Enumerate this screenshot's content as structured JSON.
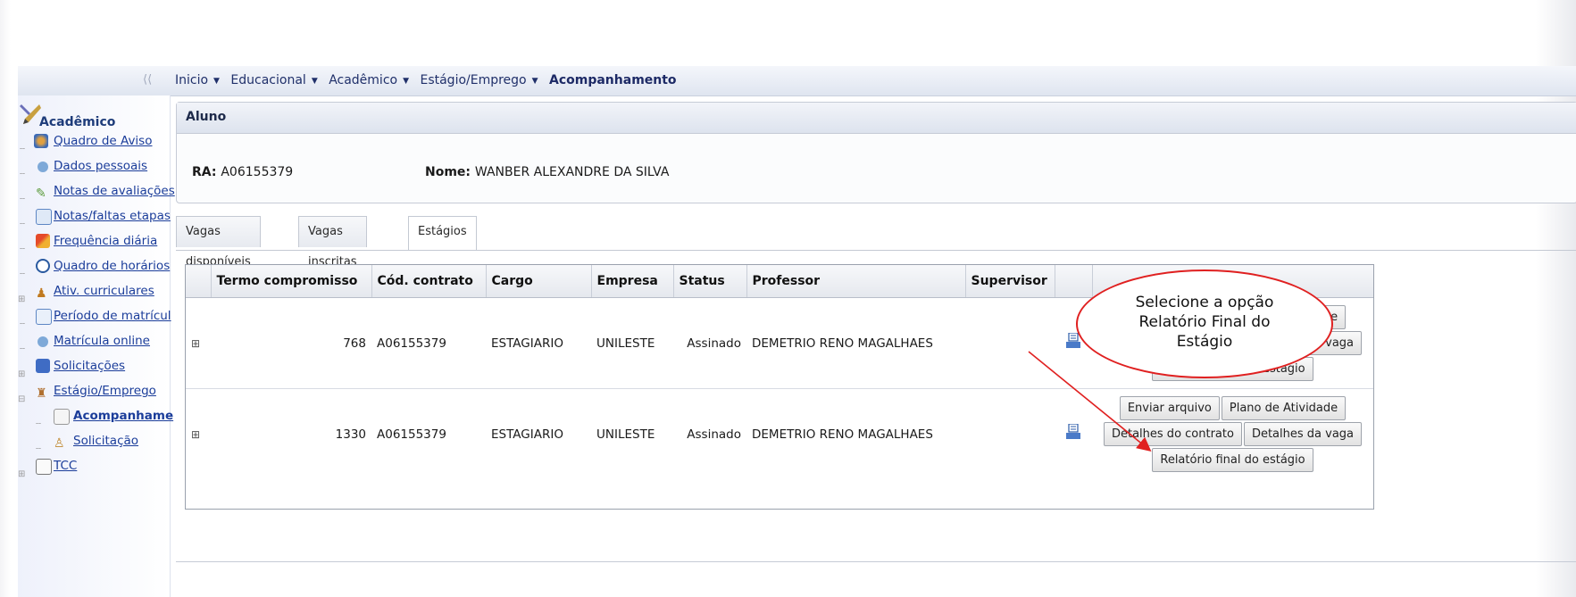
{
  "breadcrumb": {
    "collapse_glyph": "⟨⟨",
    "items": [
      "Inicio",
      "Educacional",
      "Acadêmico",
      "Estágio/Emprego"
    ],
    "current": "Acompanhamento"
  },
  "sidebar": {
    "title": "Acadêmico",
    "items": [
      {
        "label": "Quadro de Aviso",
        "icon": "people-icon"
      },
      {
        "label": "Dados pessoais",
        "icon": "person-icon"
      },
      {
        "label": "Notas de avaliações",
        "icon": "check-icon"
      },
      {
        "label": "Notas/faltas etapas",
        "icon": "list-icon"
      },
      {
        "label": "Frequência diária",
        "icon": "chart-icon"
      },
      {
        "label": "Quadro de horários",
        "icon": "clock-icon"
      },
      {
        "label": "Ativ. curriculares",
        "icon": "runner-icon"
      },
      {
        "label": "Período de matrícul",
        "icon": "calendar-icon"
      },
      {
        "label": "Matrícula online",
        "icon": "person-icon"
      },
      {
        "label": "Solicitações",
        "icon": "form-icon"
      },
      {
        "label": "Estágio/Emprego",
        "icon": "briefcase-icon"
      },
      {
        "label": "Acompanhame",
        "icon": "document-icon"
      },
      {
        "label": "Solicitação",
        "icon": "user-icon"
      },
      {
        "label": "TCC",
        "icon": "file-icon"
      }
    ]
  },
  "aluno": {
    "header": "Aluno",
    "ra_label": "RA:",
    "ra_value": "A06155379",
    "nome_label": "Nome:",
    "nome_value": "WANBER ALEXANDRE DA SILVA"
  },
  "tabs": [
    "Vagas disponíveis",
    "Vagas inscritas",
    "Estágios"
  ],
  "table": {
    "headers": [
      "Termo compromisso",
      "Cód. contrato",
      "Cargo",
      "Empresa",
      "Status",
      "Professor",
      "Supervisor"
    ],
    "rows": [
      {
        "termo": "768",
        "contrato": "A06155379",
        "cargo": "ESTAGIARIO",
        "empresa": "UNILESTE",
        "status": "Assinado",
        "professor": "DEMETRIO RENO MAGALHAES",
        "supervisor": ""
      },
      {
        "termo": "1330",
        "contrato": "A06155379",
        "cargo": "ESTAGIARIO",
        "empresa": "UNILESTE",
        "status": "Assinado",
        "professor": "DEMETRIO RENO MAGALHAES",
        "supervisor": ""
      }
    ],
    "buttons": {
      "enviar": "Enviar arquivo",
      "plano": "Plano de Atividade",
      "contrato": "Detalhes do contrato",
      "vaga": "Detalhes da vaga",
      "relatorio": "Relatório final do estágio"
    },
    "expand_glyph": "⊞"
  },
  "callout": {
    "line1": "Selecione a opção",
    "line2": "Relatório Final do",
    "line3": "Estágio",
    "color": "#e02020"
  }
}
